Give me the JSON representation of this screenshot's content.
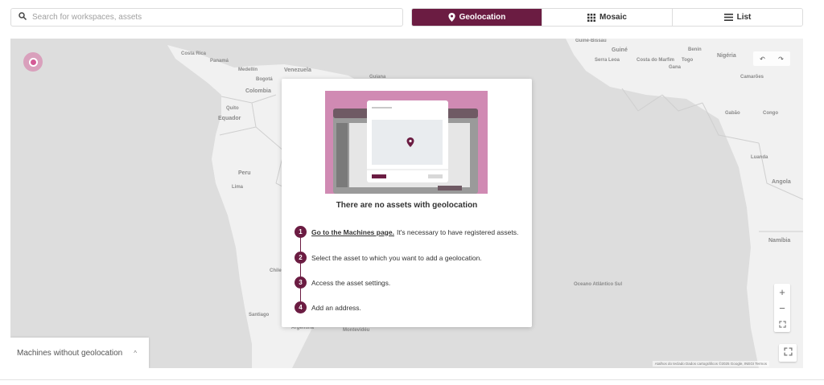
{
  "search": {
    "placeholder": "Search for workspaces, assets",
    "value": ""
  },
  "view_toggle": [
    {
      "label": "Geolocation",
      "icon": "location-pin-icon",
      "active": true
    },
    {
      "label": "Mosaic",
      "icon": "grid-icon",
      "active": false
    },
    {
      "label": "List",
      "icon": "list-icon",
      "active": false
    }
  ],
  "map": {
    "labels": [
      "Costa Rica",
      "Panamá",
      "Medellín",
      "Bogotá",
      "Colombia",
      "Venezuela",
      "Guiana",
      "Quito",
      "Equador",
      "Peru",
      "Lima",
      "Chile",
      "Argentina",
      "Montevidéu",
      "Santiago",
      "Guiné-Bissau",
      "Guiné",
      "Serra Leoa",
      "Costa do Marfim",
      "Gana",
      "Togo",
      "Benin",
      "Nigéria",
      "Camarões",
      "Gabão",
      "Congo",
      "Luanda",
      "Angola",
      "Namíbia",
      "Oceano Atlântico Sul"
    ],
    "zoom_in": "+",
    "zoom_out": "−",
    "attribution": "Atalhos do teclado   Dados cartográficos ©2025 Google, INEGI   Termos"
  },
  "machines_panel": {
    "label": "Machines without geolocation",
    "chevron": "^"
  },
  "empty_state": {
    "title": "There are no assets with geolocation",
    "steps": [
      {
        "number": "1",
        "link": "Go to the Machines page.",
        "text": "It's necessary to have registered assets."
      },
      {
        "number": "2",
        "text": "Select the asset to which you want to add a geolocation."
      },
      {
        "number": "3",
        "text": "Access the asset settings."
      },
      {
        "number": "4",
        "text": "Add an address."
      }
    ]
  },
  "colors": {
    "accent": "#6b1c42",
    "illustration_bg": "#d08ab3",
    "map_water": "#dddddd",
    "map_land": "#f1f1f1"
  }
}
